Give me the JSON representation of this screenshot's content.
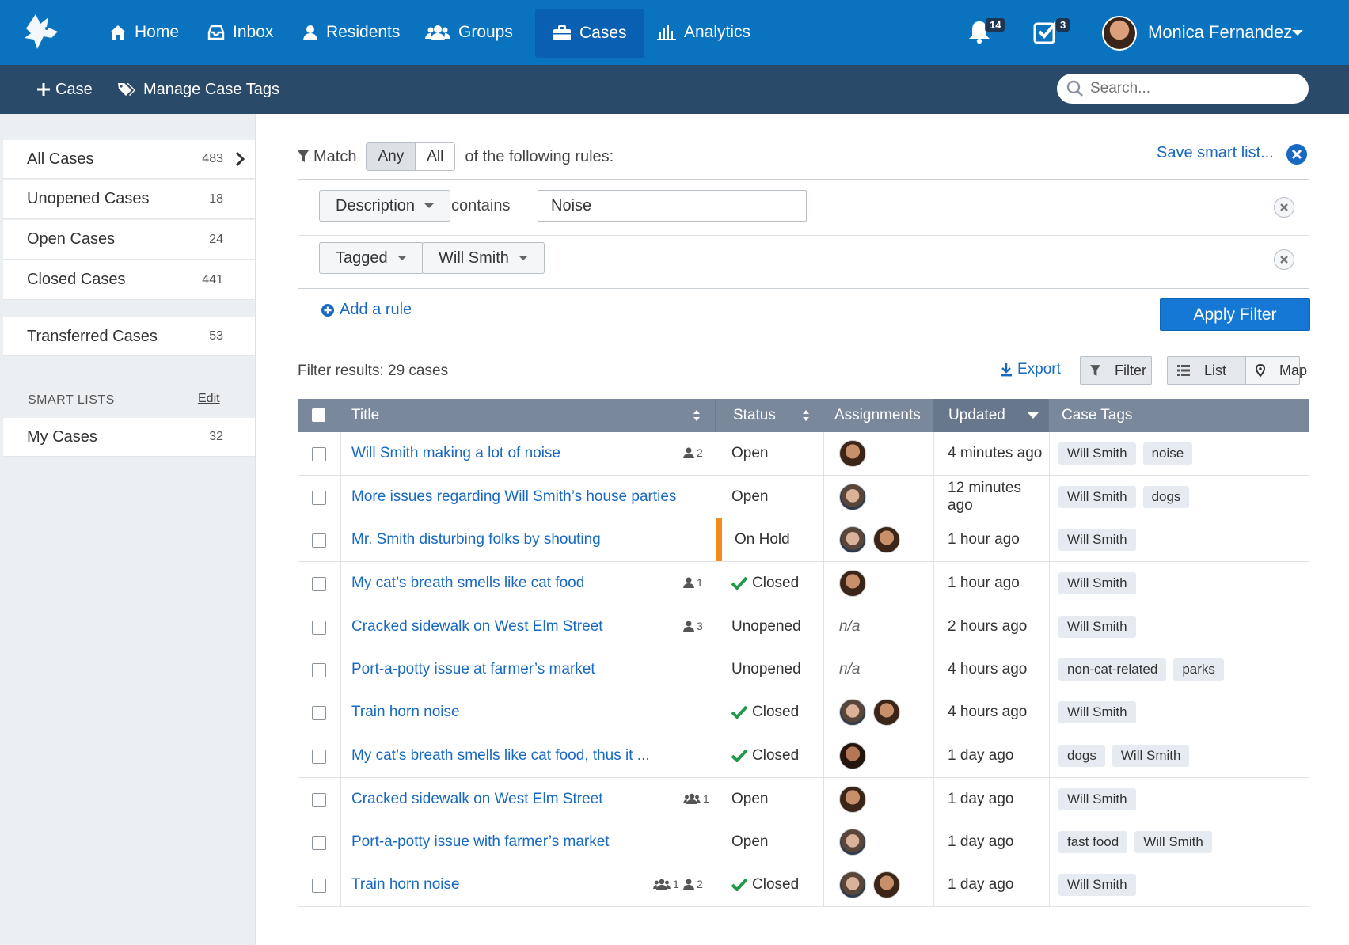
{
  "nav": {
    "items": [
      {
        "label": "Home",
        "icon": "home-icon"
      },
      {
        "label": "Inbox",
        "icon": "inbox-icon"
      },
      {
        "label": "Residents",
        "icon": "user-icon"
      },
      {
        "label": "Groups",
        "icon": "group-icon"
      },
      {
        "label": "Cases",
        "icon": "briefcase-icon",
        "active": true
      },
      {
        "label": "Analytics",
        "icon": "bar-chart-icon"
      }
    ],
    "notifications_count": "14",
    "tasks_count": "3",
    "user_name": "Monica Fernandez"
  },
  "subbar": {
    "new_case": "Case",
    "manage_tags": "Manage Case Tags",
    "search_placeholder": "Search..."
  },
  "sidebar": {
    "items": [
      {
        "label": "All Cases",
        "count": "483"
      },
      {
        "label": "Unopened Cases",
        "count": "18"
      },
      {
        "label": "Open Cases",
        "count": "24"
      },
      {
        "label": "Closed Cases",
        "count": "441"
      },
      {
        "label": "Transferred Cases",
        "count": "53"
      }
    ],
    "smart_lists_title": "SMART LISTS",
    "smart_lists_edit": "Edit",
    "smart_items": [
      {
        "label": "My Cases",
        "count": "32"
      }
    ]
  },
  "filter": {
    "match_label": "Match",
    "match_any": "Any",
    "match_all": "All",
    "match_suffix": "of the following rules:",
    "save_link": "Save smart list...",
    "rule1_field": "Description",
    "rule1_op": "contains",
    "rule1_value": "Noise",
    "rule2_field": "Tagged",
    "rule2_value": "Will Smith",
    "add_rule": "Add a rule",
    "apply": "Apply Filter"
  },
  "results": {
    "summary": "Filter results: 29 cases",
    "export": "Export",
    "filter_btn": "Filter",
    "list_btn": "List",
    "map_btn": "Map"
  },
  "table": {
    "columns": [
      "Title",
      "Status",
      "Assignments",
      "Updated",
      "Case Tags"
    ],
    "rows": [
      {
        "title": "Will Smith making a lot of noise",
        "users": "2",
        "groups": "",
        "status": "Open",
        "check": false,
        "assign": [
          "av1"
        ],
        "updated": "4 minutes ago",
        "tags": [
          "Will Smith",
          "noise"
        ]
      },
      {
        "title": "More issues regarding Will Smith’s house parties",
        "users": "",
        "groups": "",
        "status": "Open",
        "check": false,
        "assign": [
          "av2"
        ],
        "updated": "12 minutes ago",
        "tags": [
          "Will Smith",
          "dogs"
        ]
      },
      {
        "title": "Mr. Smith disturbing folks by shouting",
        "users": "",
        "groups": "",
        "status": "On Hold",
        "check": false,
        "assign": [
          "av2",
          "av1"
        ],
        "updated": "1 hour ago",
        "tags": [
          "Will Smith"
        ]
      },
      {
        "title": "My cat’s breath smells like cat food",
        "users": "1",
        "groups": "",
        "status": "Closed",
        "check": true,
        "assign": [
          "av1"
        ],
        "updated": "1 hour ago",
        "tags": [
          "Will Smith"
        ]
      },
      {
        "title": "Cracked sidewalk on West Elm Street",
        "users": "3",
        "groups": "",
        "status": "Unopened",
        "check": false,
        "assign": [],
        "assign_text": "n/a",
        "updated": "2 hours ago",
        "tags": [
          "Will Smith"
        ]
      },
      {
        "title": "Port-a-potty issue at farmer’s market",
        "users": "",
        "groups": "",
        "status": "Unopened",
        "check": false,
        "assign": [],
        "assign_text": "n/a",
        "updated": "4 hours ago",
        "tags": [
          "non-cat-related",
          "parks"
        ]
      },
      {
        "title": "Train horn noise",
        "users": "",
        "groups": "",
        "status": "Closed",
        "check": true,
        "assign": [
          "av2",
          "av1"
        ],
        "updated": "4 hours ago",
        "tags": [
          "Will Smith"
        ]
      },
      {
        "title": "My cat’s breath smells like cat food, thus it ...",
        "users": "",
        "groups": "",
        "status": "Closed",
        "check": true,
        "assign": [
          "av3"
        ],
        "updated": "1 day ago",
        "tags": [
          "dogs",
          "Will Smith"
        ]
      },
      {
        "title": "Cracked sidewalk on West Elm Street",
        "users": "",
        "groups": "1",
        "status": "Open",
        "check": false,
        "assign": [
          "av1"
        ],
        "updated": "1 day ago",
        "tags": [
          "Will Smith"
        ]
      },
      {
        "title": "Port-a-potty issue with farmer’s market",
        "users": "",
        "groups": "",
        "status": "Open",
        "check": false,
        "assign": [
          "av2"
        ],
        "updated": "1 day ago",
        "tags": [
          "fast food",
          "Will Smith"
        ]
      },
      {
        "title": "Train horn noise",
        "users": "2",
        "groups": "1",
        "status": "Closed",
        "check": true,
        "assign": [
          "av2",
          "av1"
        ],
        "updated": "1 day ago",
        "tags": [
          "Will Smith"
        ]
      }
    ]
  },
  "colors": {
    "nav_blue": "#0a73c0",
    "subbar": "#2a4a6a",
    "link": "#1769c2",
    "on_hold": "#f08b1c",
    "closed_check": "#1f9a4a"
  }
}
